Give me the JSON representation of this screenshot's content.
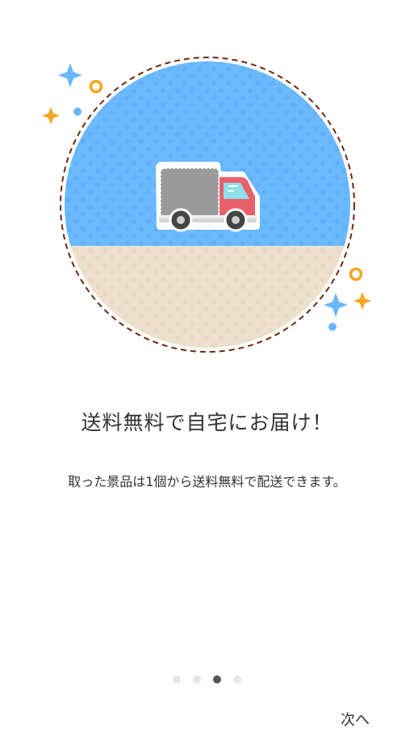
{
  "onboarding": {
    "title": "送料無料で自宅にお届け！",
    "description": "取った景品は1個から送料無料で配送できます。",
    "illustration_icon": "delivery-truck-icon",
    "pager": {
      "total": 4,
      "current": 3
    },
    "next_label": "次へ"
  },
  "colors": {
    "sky": "#6bb9ff",
    "ground": "#ede0cc",
    "border_dash": "#6b2a0f",
    "truck_cab": "#e8606a",
    "truck_cargo": "#9a9a9a",
    "sparkle_blue": "#6ab6ff",
    "sparkle_orange": "#f5a623",
    "text": "#333333"
  }
}
